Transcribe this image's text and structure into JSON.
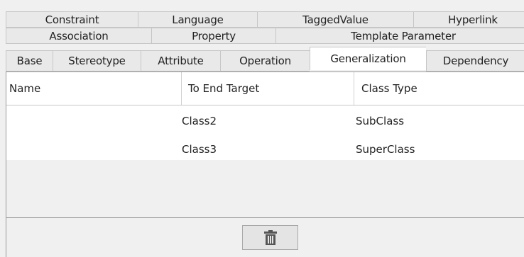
{
  "tabs": {
    "row1": [
      "Constraint",
      "Language",
      "TaggedValue",
      "Hyperlink"
    ],
    "row2": [
      "Association",
      "Property",
      "Template Parameter"
    ],
    "row3": [
      "Base",
      "Stereotype",
      "Attribute",
      "Operation",
      "Generalization",
      "Dependency"
    ],
    "active": "Generalization"
  },
  "table": {
    "columns": [
      "Name",
      "To End Target",
      "Class Type"
    ],
    "rows": [
      {
        "name": "",
        "target": "Class2",
        "type": "SubClass"
      },
      {
        "name": "",
        "target": "Class3",
        "type": "SuperClass"
      }
    ]
  },
  "footer": {
    "delete_icon": "trash-icon"
  }
}
